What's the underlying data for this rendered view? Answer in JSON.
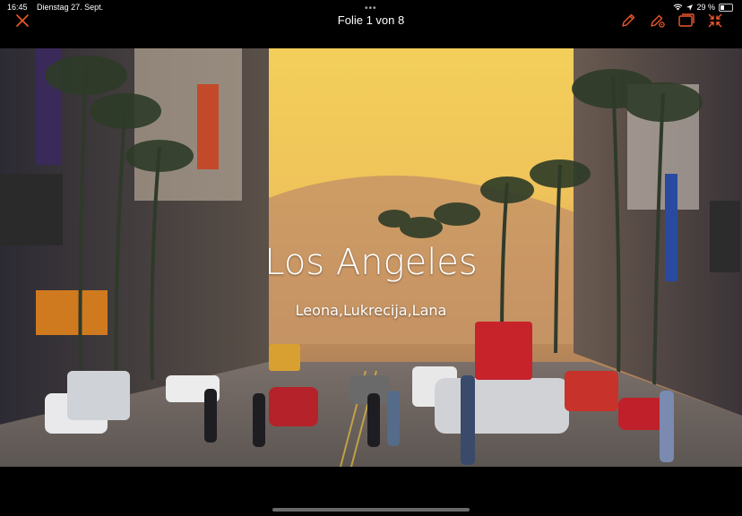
{
  "status": {
    "time": "16:45",
    "date": "Dienstag 27. Sept.",
    "battery": "29 %",
    "battery_level": 0.29
  },
  "toolbar": {
    "title": "Folie 1 von 8"
  },
  "slide": {
    "title": "Los Angeles",
    "subtitle": "Leona,Lukrecija,Lana"
  },
  "colors": {
    "accent": "#f0582e",
    "toolbar_bg": "#000000"
  },
  "icons": [
    "close-icon",
    "pen-icon",
    "pen-settings-icon",
    "slides-icon",
    "collapse-icon",
    "wifi-icon",
    "battery-icon"
  ]
}
